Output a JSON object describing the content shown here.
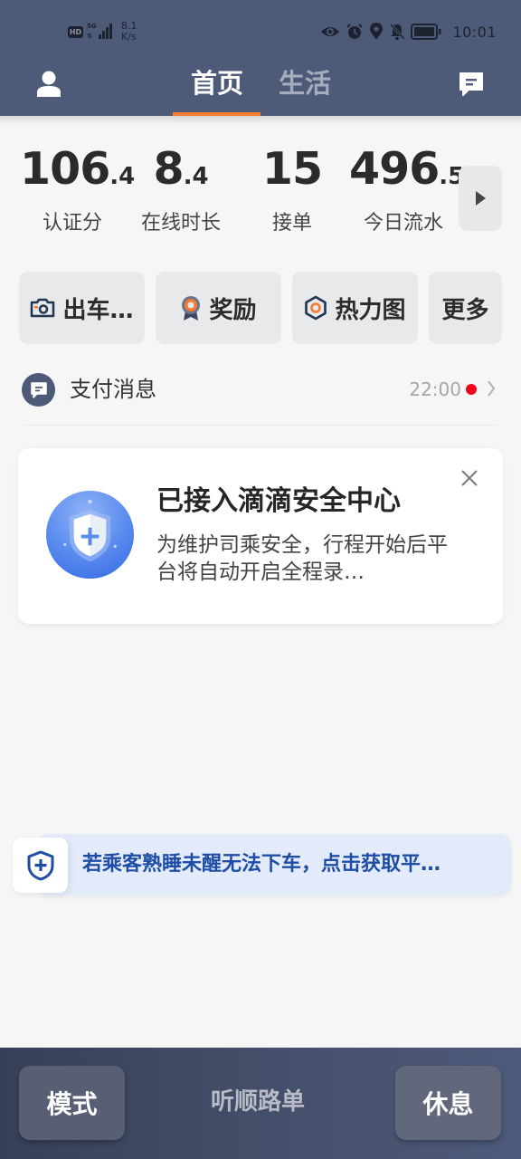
{
  "status_bar": {
    "hd_label": "HD",
    "network_label": "5G",
    "net_speed_value": "8.1",
    "net_speed_unit": "K/s",
    "icons": [
      "eye-icon",
      "alarm-icon",
      "location-icon",
      "bell-off-icon",
      "battery-icon"
    ],
    "time": "10:01"
  },
  "header": {
    "tabs": [
      {
        "label": "首页",
        "active": true
      },
      {
        "label": "生活",
        "active": false
      }
    ],
    "left_icon": "user-icon",
    "right_icon": "message-icon",
    "accent_color": "#f47b2f",
    "background_color": "#4e5b78"
  },
  "stats": [
    {
      "int": "106",
      "dec": ".4",
      "label": "认证分"
    },
    {
      "int": "8",
      "dec": ".4",
      "label": "在线时长"
    },
    {
      "int": "15",
      "dec": "",
      "label": "接单"
    },
    {
      "int": "496",
      "dec": ".5",
      "label": "今日流水"
    }
  ],
  "stats_more_icon": "play-right-icon",
  "actions": [
    {
      "label": "出车…",
      "icon": "camera-icon"
    },
    {
      "label": "奖励",
      "icon": "medal-icon"
    },
    {
      "label": "热力图",
      "icon": "hexagon-icon"
    },
    {
      "label": "更多",
      "icon": ""
    }
  ],
  "message": {
    "title": "支付消息",
    "time": "22:00",
    "unread": true,
    "icon": "chat-bubble-icon"
  },
  "safety_card": {
    "title": "已接入滴滴安全中心",
    "description": "为维护司乘安全，行程开始后平台将自动开启全程录…",
    "icon": "shield-plus-icon",
    "close_icon": "close-icon"
  },
  "tip_banner": {
    "text": "若乘客熟睡未醒无法下车，点击获取平…",
    "icon": "shield-plus-icon",
    "text_color": "#1f4da6"
  },
  "bottom_bar": {
    "left_button": "模式",
    "center_label": "听顺路单",
    "right_button": "休息"
  }
}
